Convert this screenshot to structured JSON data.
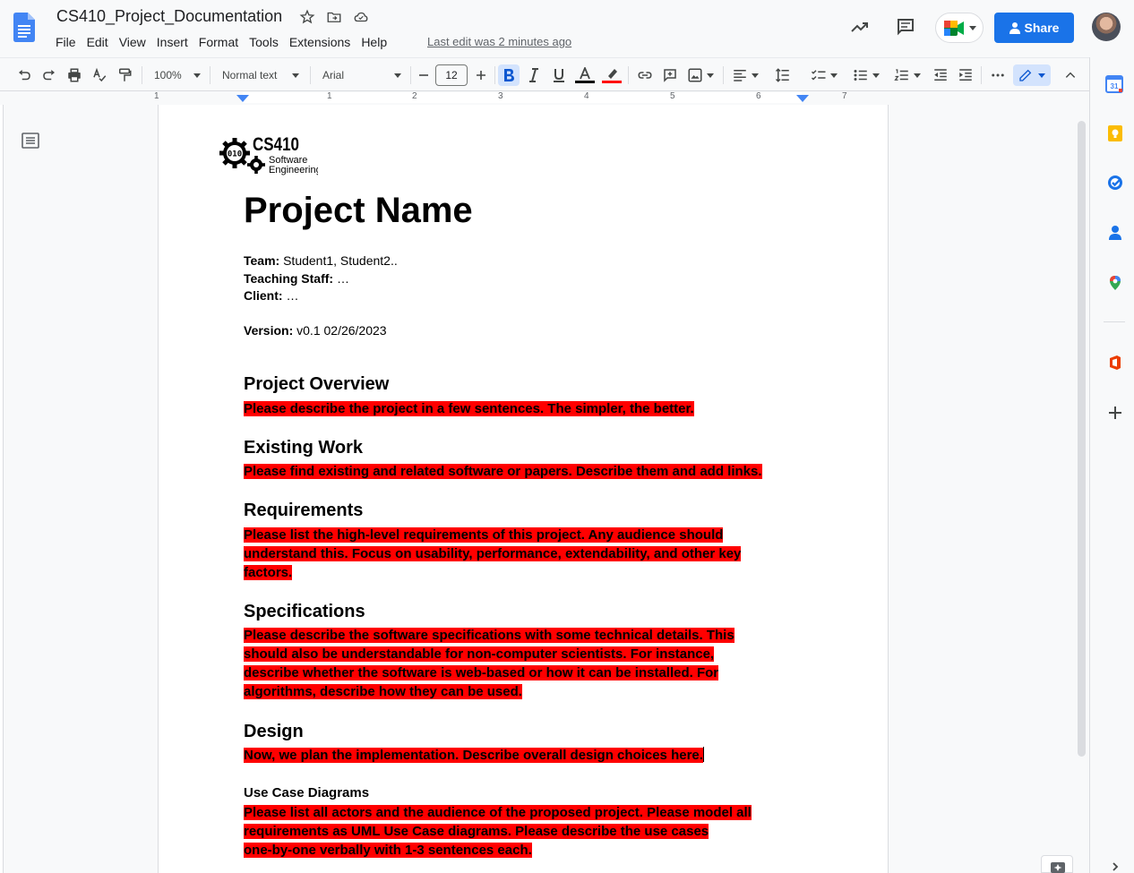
{
  "doc_title": "CS410_Project_Documentation",
  "menu": [
    "File",
    "Edit",
    "View",
    "Insert",
    "Format",
    "Tools",
    "Extensions",
    "Help"
  ],
  "last_edit": "Last edit was 2 minutes ago",
  "share_label": "Share",
  "toolbar": {
    "zoom": "100%",
    "style": "Normal text",
    "font": "Arial",
    "font_size": "12"
  },
  "ruler_labels": [
    "1",
    "1",
    "2",
    "3",
    "4",
    "5",
    "6",
    "7"
  ],
  "logo": {
    "title": "CS410",
    "line1": "Software",
    "line2": "Engineering"
  },
  "document": {
    "title": "Project Name",
    "team_label": "Team:",
    "team_value": " Student1, Student2..",
    "staff_label": "Teaching Staff:",
    "staff_value": " …",
    "client_label": "Client:",
    "client_value": " …",
    "version_label": "Version:",
    "version_value": " v0.1 02/26/2023",
    "sections": {
      "overview_heading": "Project Overview",
      "overview_text": "Please describe the project in a few sentences. The simpler, the better.",
      "existing_heading": "Existing Work",
      "existing_text": "Please find existing and related software or papers. Describe them and add links.",
      "req_heading": "Requirements",
      "req_line1": "Please list the high-level requirements of this project. Any audience should",
      "req_line2": "understand this. Focus on usability, performance, extendability, and other key",
      "req_line3": "factors.",
      "spec_heading": "Specifications",
      "spec_line1": "Please describe the software specifications with some technical details. This",
      "spec_line2": "should also be understandable for non-computer scientists. For instance,",
      "spec_line3": "describe whether the software is web-based or how it can be installed. For",
      "spec_line4": "algorithms, describe how they can be used.",
      "design_heading": "Design",
      "design_text": "Now, we plan the implementation. Describe overall design choices here.",
      "usecase_heading": "Use Case Diagrams",
      "usecase_line1": "Please list all actors and the audience of the proposed project. Please model all",
      "usecase_line2": "requirements as UML Use Case diagrams. Please describe the use cases",
      "usecase_line3": "one-by-one verbally with 1-3 sentences each."
    }
  },
  "colors": {
    "highlight": "#ff0000",
    "share": "#1a73e8",
    "docs_blue": "#4285f4"
  }
}
